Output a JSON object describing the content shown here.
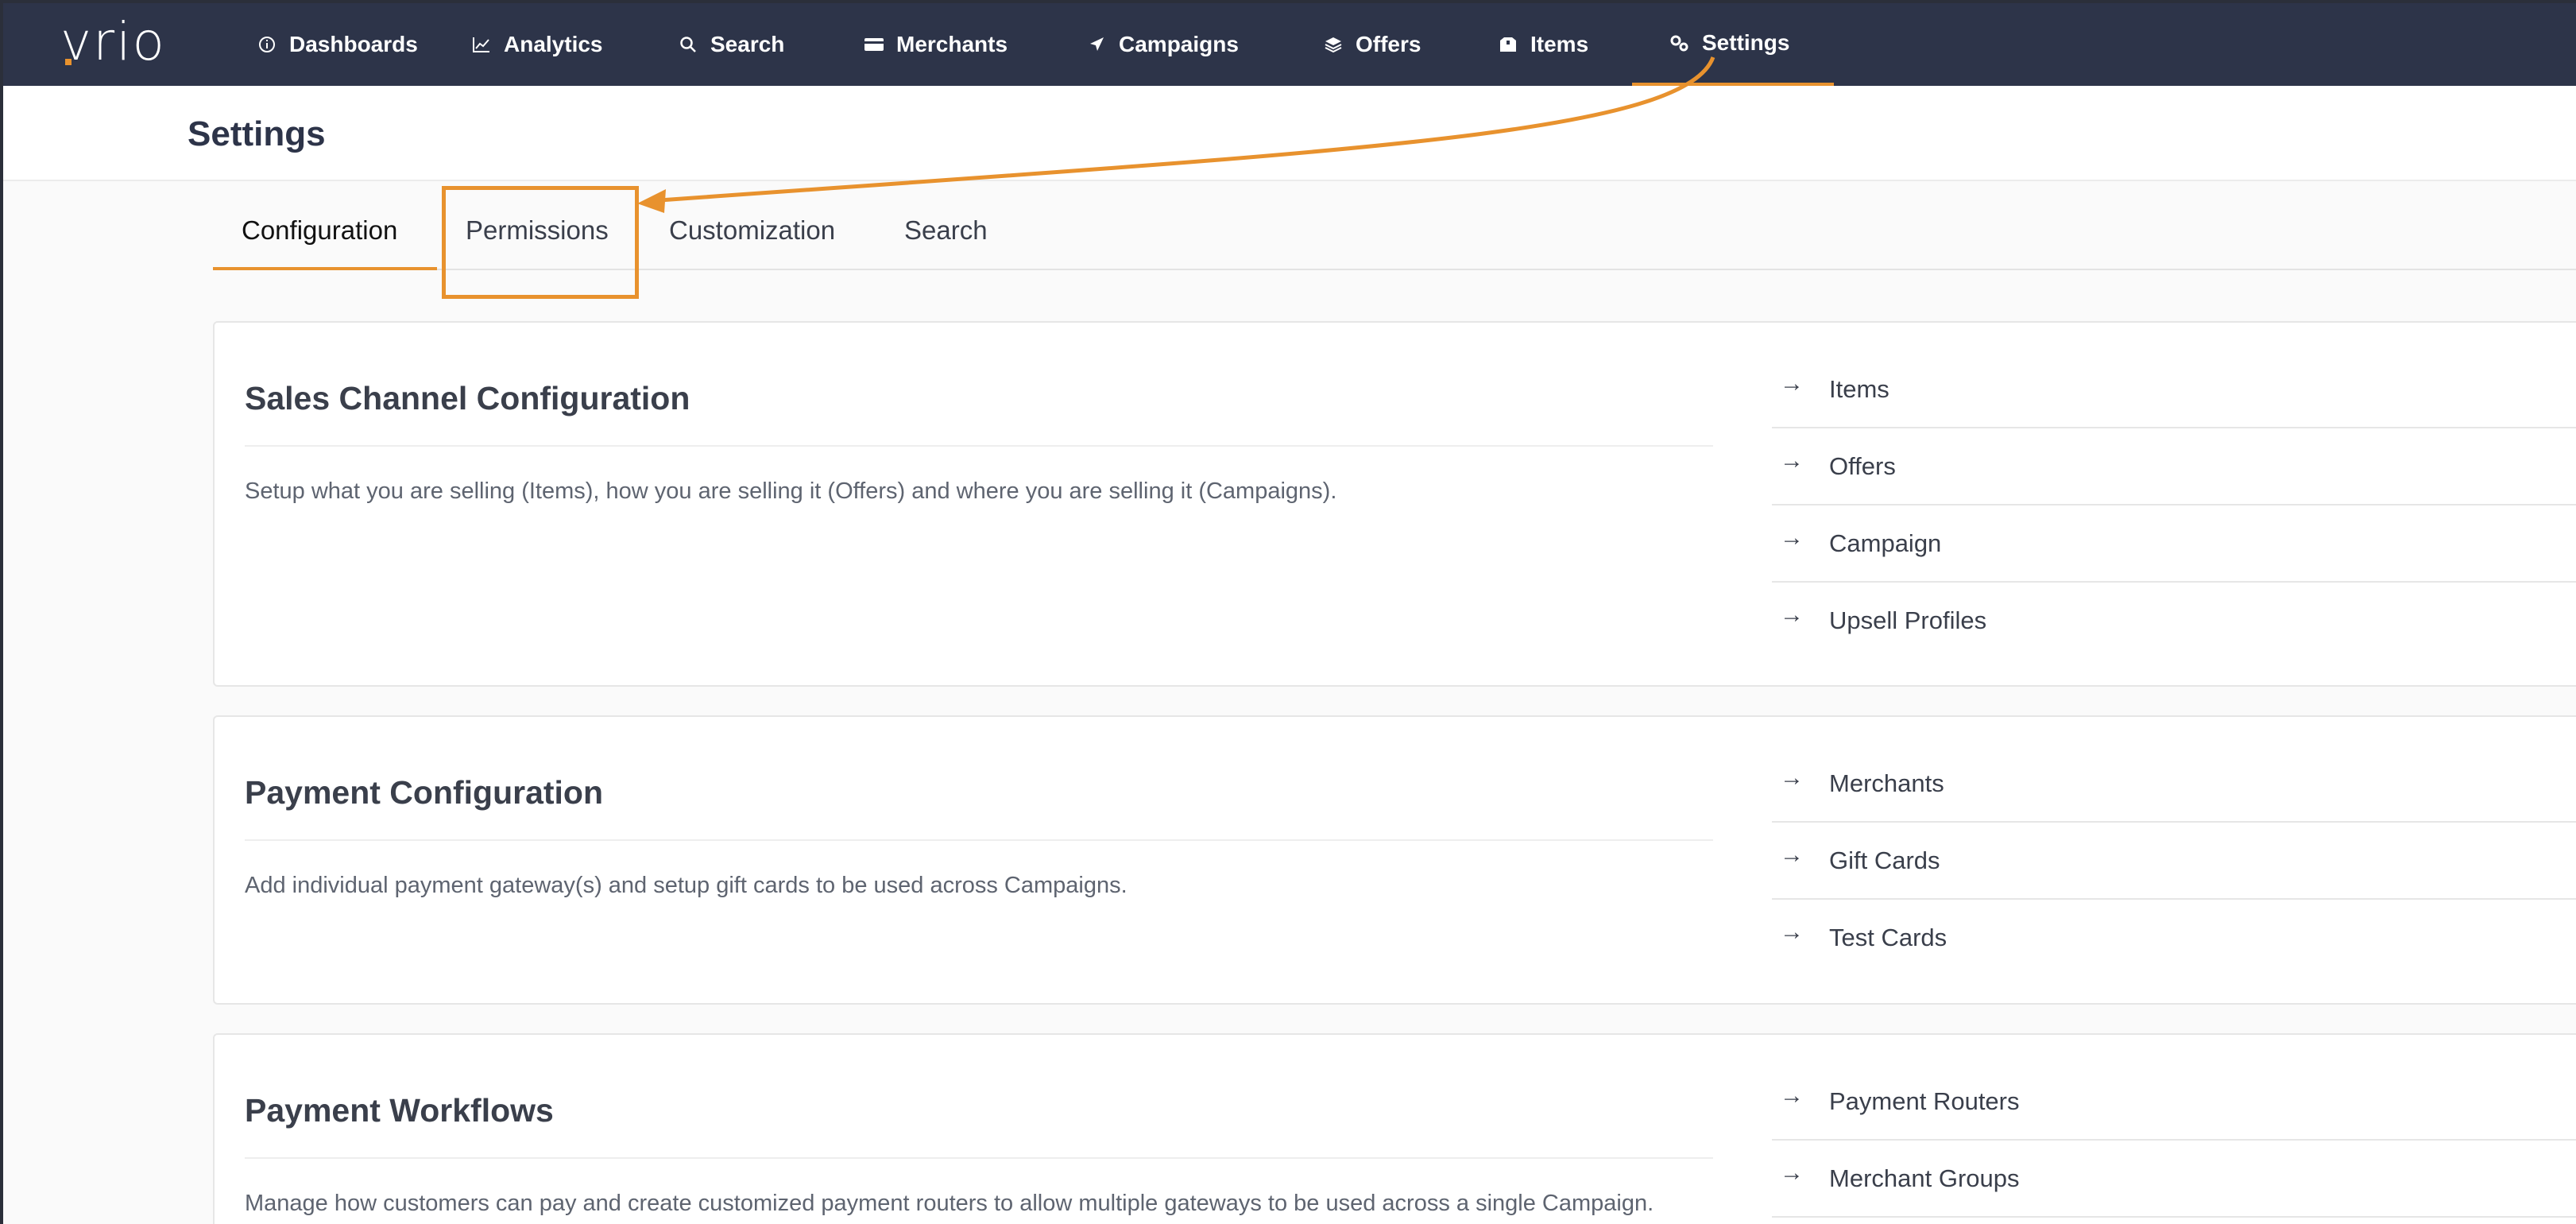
{
  "brand": {
    "name": "vrio",
    "accent": "#e8922e",
    "nav_bg": "#2d3449"
  },
  "nav": {
    "items": [
      {
        "label": "Dashboards",
        "icon": "info-circle-icon"
      },
      {
        "label": "Analytics",
        "icon": "line-chart-icon"
      },
      {
        "label": "Search",
        "icon": "search-icon"
      },
      {
        "label": "Merchants",
        "icon": "credit-card-icon"
      },
      {
        "label": "Campaigns",
        "icon": "paper-plane-icon"
      },
      {
        "label": "Offers",
        "icon": "layers-icon"
      },
      {
        "label": "Items",
        "icon": "box-icon"
      },
      {
        "label": "Settings",
        "icon": "gears-icon"
      }
    ],
    "active": "Settings"
  },
  "page": {
    "title": "Settings"
  },
  "tabs": {
    "items": [
      "Configuration",
      "Permissions",
      "Customization",
      "Search"
    ],
    "active": "Configuration",
    "highlighted": "Permissions"
  },
  "sections": [
    {
      "title": "Sales Channel Configuration",
      "description": "Setup what you are selling (Items), how you are selling it (Offers) and where you are selling it (Campaigns).",
      "links": [
        "Items",
        "Offers",
        "Campaign",
        "Upsell Profiles"
      ]
    },
    {
      "title": "Payment Configuration",
      "description": "Add individual payment gateway(s) and setup gift cards to be used across Campaigns.",
      "links": [
        "Merchants",
        "Gift Cards",
        "Test Cards"
      ]
    },
    {
      "title": "Payment Workflows",
      "description": "Manage how customers can pay and create customized payment routers to allow multiple gateways to be used across a single Campaign.",
      "links": [
        "Payment Routers",
        "Merchant Groups"
      ]
    }
  ]
}
